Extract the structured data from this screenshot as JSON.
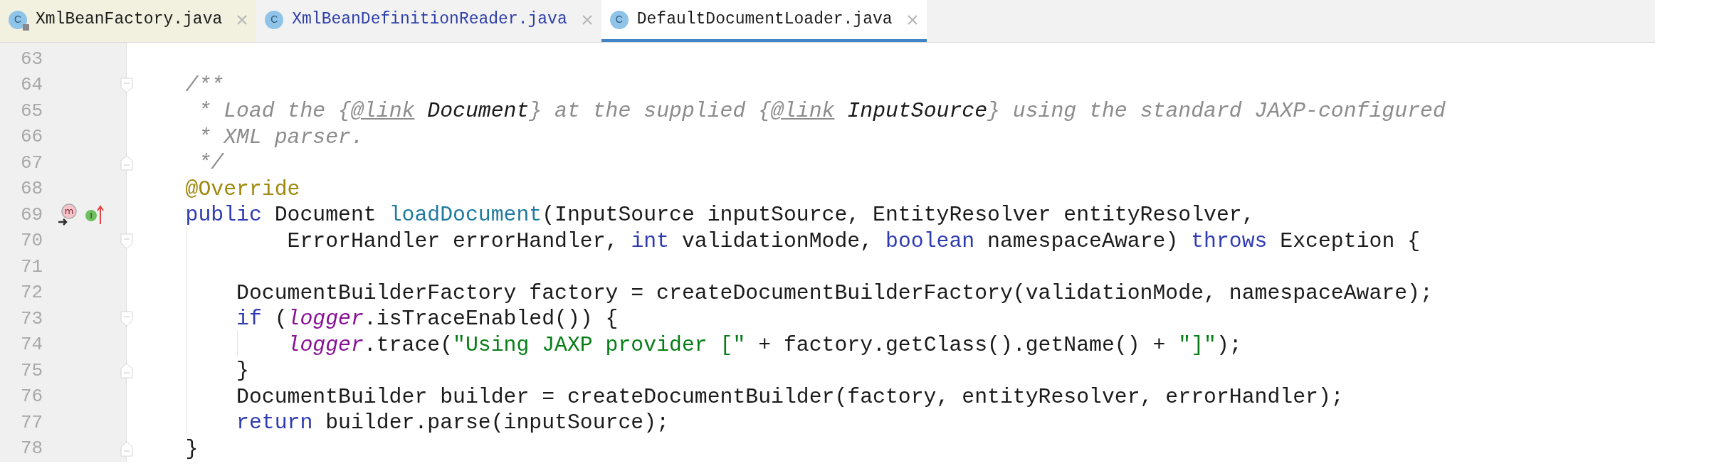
{
  "tabs": [
    {
      "label": "XmlBeanFactory.java",
      "icon_glyph": "C",
      "selected": false,
      "read_only": true,
      "modified": false
    },
    {
      "label": "XmlBeanDefinitionReader.java",
      "icon_glyph": "C",
      "selected": false,
      "read_only": false,
      "modified": true
    },
    {
      "label": "DefaultDocumentLoader.java",
      "icon_glyph": "C",
      "selected": true,
      "read_only": false,
      "modified": false
    }
  ],
  "lines": [
    {
      "number": "63",
      "fold_open": false,
      "fold_close": false
    },
    {
      "number": "64",
      "fold_open": true,
      "fold_close": false,
      "tokens": [
        {
          "kind": "comment",
          "text": "    /**"
        }
      ]
    },
    {
      "number": "65",
      "fold_open": false,
      "fold_close": false,
      "tokens": [
        {
          "kind": "comment",
          "text": "     * Load the {"
        },
        {
          "kind": "doctag",
          "text": "@link"
        },
        {
          "kind": "docref",
          "text": " Document"
        },
        {
          "kind": "comment",
          "text": "} at the supplied {"
        },
        {
          "kind": "doctag",
          "text": "@link"
        },
        {
          "kind": "docref",
          "text": " InputSource"
        },
        {
          "kind": "comment",
          "text": "} using the standard JAXP-configured"
        }
      ]
    },
    {
      "number": "66",
      "fold_open": false,
      "fold_close": false,
      "tokens": [
        {
          "kind": "comment",
          "text": "     * XML parser."
        }
      ]
    },
    {
      "number": "67",
      "fold_open": false,
      "fold_close": true,
      "tokens": [
        {
          "kind": "comment",
          "text": "     */"
        }
      ]
    },
    {
      "number": "68",
      "fold_open": false,
      "fold_close": false,
      "tokens": [
        {
          "kind": "annotation",
          "text": "    @Override"
        }
      ]
    },
    {
      "number": "69",
      "fold_open": false,
      "fold_close": false,
      "marks": [
        {
          "kind": "override",
          "glyph": "m"
        },
        {
          "kind": "implements",
          "glyph": "I"
        }
      ],
      "tokens": [
        {
          "kind": "keyword",
          "text": "    public"
        },
        {
          "kind": "plain",
          "text": " Document "
        },
        {
          "kind": "declaration",
          "text": "loadDocument"
        },
        {
          "kind": "plain",
          "text": "(InputSource inputSource, EntityResolver entityResolver,"
        }
      ]
    },
    {
      "number": "70",
      "fold_open": true,
      "fold_close": false,
      "tokens": [
        {
          "kind": "plain",
          "text": "            ErrorHandler errorHandler, "
        },
        {
          "kind": "keyword",
          "text": "int"
        },
        {
          "kind": "plain",
          "text": " validationMode, "
        },
        {
          "kind": "keyword",
          "text": "boolean"
        },
        {
          "kind": "plain",
          "text": " namespaceAware) "
        },
        {
          "kind": "keyword",
          "text": "throws"
        },
        {
          "kind": "plain",
          "text": " Exception {"
        }
      ]
    },
    {
      "number": "71",
      "fold_open": false,
      "fold_close": false
    },
    {
      "number": "72",
      "fold_open": false,
      "fold_close": false,
      "tokens": [
        {
          "kind": "plain",
          "text": "        DocumentBuilderFactory factory = createDocumentBuilderFactory(validationMode, namespaceAware);"
        }
      ]
    },
    {
      "number": "73",
      "fold_open": true,
      "fold_close": false,
      "tokens": [
        {
          "kind": "keyword",
          "text": "        if"
        },
        {
          "kind": "plain",
          "text": " ("
        },
        {
          "kind": "field",
          "text": "logger"
        },
        {
          "kind": "plain",
          "text": ".isTraceEnabled()) {"
        }
      ]
    },
    {
      "number": "74",
      "fold_open": false,
      "fold_close": false,
      "tokens": [
        {
          "kind": "field",
          "text": "            logger"
        },
        {
          "kind": "plain",
          "text": ".trace("
        },
        {
          "kind": "string",
          "text": "\"Using JAXP provider [\""
        },
        {
          "kind": "plain",
          "text": " + factory.getClass().getName() + "
        },
        {
          "kind": "string",
          "text": "\"]\""
        },
        {
          "kind": "plain",
          "text": ");"
        }
      ]
    },
    {
      "number": "75",
      "fold_open": false,
      "fold_close": true,
      "tokens": [
        {
          "kind": "plain",
          "text": "        }"
        }
      ]
    },
    {
      "number": "76",
      "fold_open": false,
      "fold_close": false,
      "tokens": [
        {
          "kind": "plain",
          "text": "        DocumentBuilder builder = createDocumentBuilder(factory, entityResolver, errorHandler);"
        }
      ]
    },
    {
      "number": "77",
      "fold_open": false,
      "fold_close": false,
      "tokens": [
        {
          "kind": "keyword",
          "text": "        return"
        },
        {
          "kind": "plain",
          "text": " builder.parse(inputSource);"
        }
      ]
    },
    {
      "number": "78",
      "fold_open": false,
      "fold_close": true,
      "tokens": [
        {
          "kind": "plain",
          "text": "    }"
        }
      ]
    }
  ]
}
